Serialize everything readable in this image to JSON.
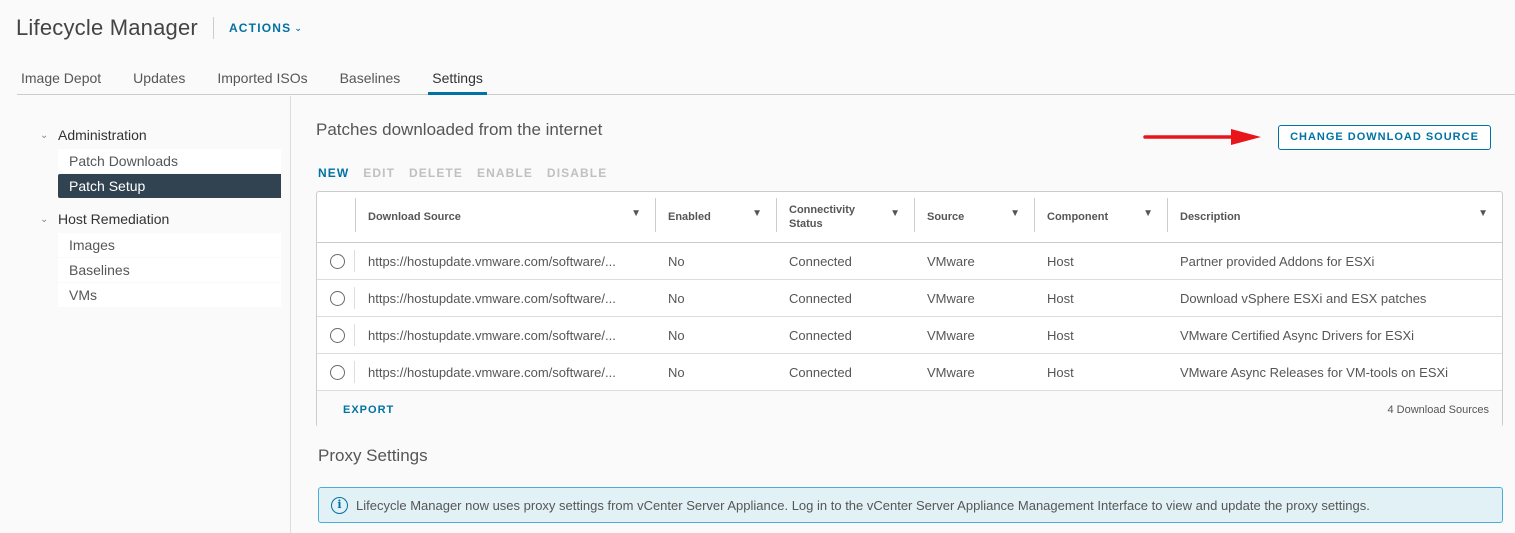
{
  "header": {
    "title": "Lifecycle Manager",
    "actions_label": "ACTIONS",
    "actions_icon": "chevron-down-icon"
  },
  "tabs": [
    {
      "label": "Image Depot",
      "active": false
    },
    {
      "label": "Updates",
      "active": false
    },
    {
      "label": "Imported ISOs",
      "active": false
    },
    {
      "label": "Baselines",
      "active": false
    },
    {
      "label": "Settings",
      "active": true
    }
  ],
  "sidebar": {
    "groups": [
      {
        "label": "Administration",
        "expanded": true,
        "items": [
          {
            "label": "Patch Downloads",
            "active": false
          },
          {
            "label": "Patch Setup",
            "active": true
          }
        ]
      },
      {
        "label": "Host Remediation",
        "expanded": true,
        "items": [
          {
            "label": "Images",
            "active": false
          },
          {
            "label": "Baselines",
            "active": false
          },
          {
            "label": "VMs",
            "active": false
          }
        ]
      }
    ]
  },
  "main": {
    "section_title": "Patches downloaded from the internet",
    "change_source_label": "CHANGE DOWNLOAD SOURCE",
    "annotation_arrow_color": "#e8161a",
    "toolbar": {
      "new": "NEW",
      "edit": "EDIT",
      "delete": "DELETE",
      "enable": "ENABLE",
      "disable": "DISABLE"
    },
    "grid": {
      "columns": [
        "Download Source",
        "Enabled",
        "Connectivity Status",
        "Source",
        "Component",
        "Description"
      ],
      "column_lines": {
        "connectivity_1": "Connectivity",
        "connectivity_2": "Status"
      },
      "rows": [
        {
          "download_source": "https://hostupdate.vmware.com/software/...",
          "enabled": "No",
          "connectivity": "Connected",
          "source": "VMware",
          "component": "Host",
          "description": "Partner provided Addons for ESXi"
        },
        {
          "download_source": "https://hostupdate.vmware.com/software/...",
          "enabled": "No",
          "connectivity": "Connected",
          "source": "VMware",
          "component": "Host",
          "description": "Download vSphere ESXi and ESX patches"
        },
        {
          "download_source": "https://hostupdate.vmware.com/software/...",
          "enabled": "No",
          "connectivity": "Connected",
          "source": "VMware",
          "component": "Host",
          "description": "VMware Certified Async Drivers for ESXi"
        },
        {
          "download_source": "https://hostupdate.vmware.com/software/...",
          "enabled": "No",
          "connectivity": "Connected",
          "source": "VMware",
          "component": "Host",
          "description": "VMware Async Releases for VM-tools on ESXi"
        }
      ],
      "export_label": "EXPORT",
      "count_label": "4 Download Sources"
    },
    "proxy": {
      "title": "Proxy Settings",
      "alert_text": "Lifecycle Manager now uses proxy settings from vCenter Server Appliance. Log in to the vCenter Server Appliance Management Interface to view and update the proxy settings."
    }
  },
  "colors": {
    "accent": "#0072a3",
    "selected_nav": "#314351",
    "info_bg": "#e1f1f6",
    "info_border": "#49afd9"
  }
}
